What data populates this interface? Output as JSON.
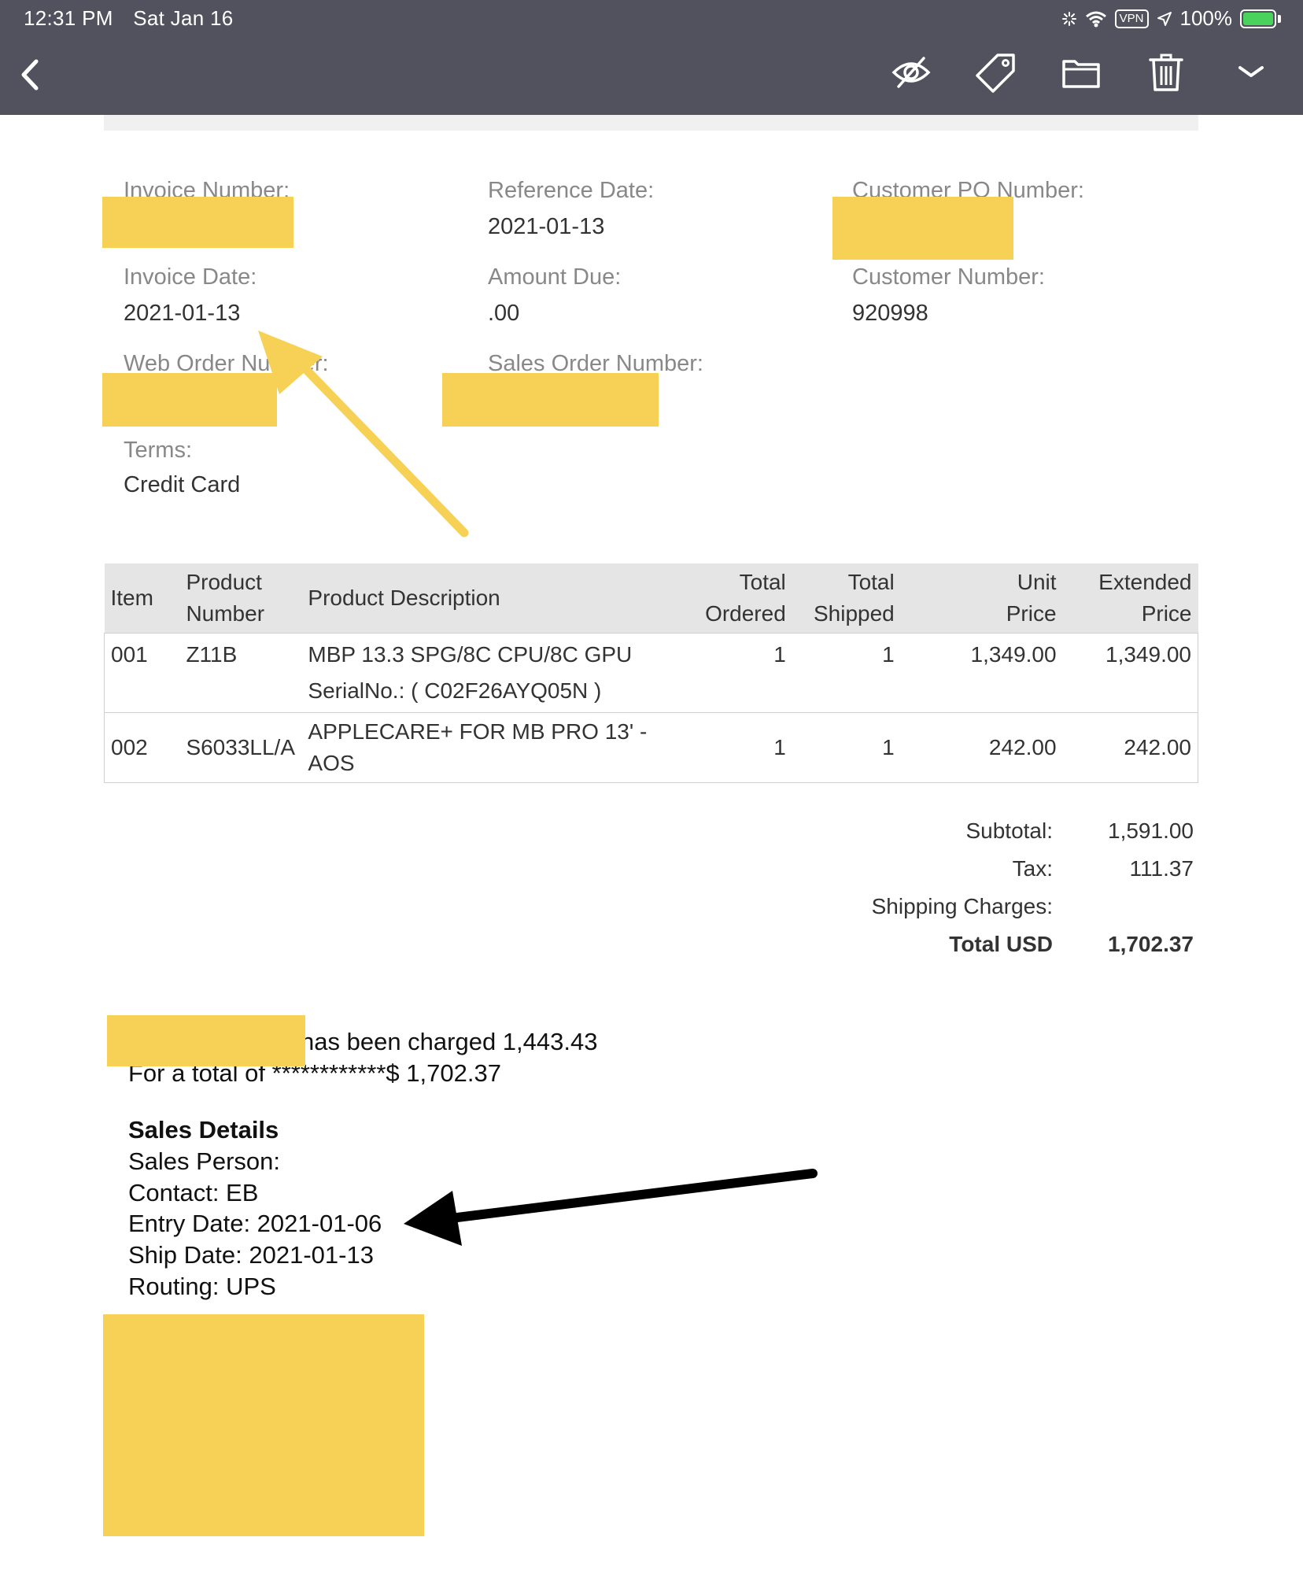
{
  "status": {
    "time": "12:31 PM",
    "date": "Sat Jan 16",
    "vpn": "VPN",
    "battery": "100%"
  },
  "toolbar": {
    "icons": [
      "back-icon",
      "hide-icon",
      "tag-icon",
      "folder-icon",
      "trash-icon",
      "chevron-down-icon"
    ]
  },
  "invoice": {
    "invoice_number_label": "Invoice Number:",
    "reference_date_label": "Reference Date:",
    "reference_date": "2021-01-13",
    "customer_po_label": "Customer PO Number:",
    "invoice_date_label": "Invoice Date:",
    "invoice_date": "2021-01-13",
    "amount_due_label": "Amount Due:",
    "amount_due": ".00",
    "customer_number_label": "Customer Number:",
    "customer_number": "920998",
    "web_order_label": "Web Order Number:",
    "sales_order_label": "Sales Order Number:",
    "terms_label": "Terms:",
    "terms": "Credit Card"
  },
  "table": {
    "headers": {
      "item": "Item",
      "product_number_1": "Product",
      "product_number_2": "Number",
      "description": "Product Description",
      "ordered_1": "Total",
      "ordered_2": "Ordered",
      "shipped_1": "Total",
      "shipped_2": "Shipped",
      "unit_1": "Unit",
      "unit_2": "Price",
      "ext_1": "Extended",
      "ext_2": "Price"
    },
    "rows": [
      {
        "item": "001",
        "product": "Z11B",
        "desc1": "MBP 13.3 SPG/8C CPU/8C GPU",
        "desc2": "SerialNo.: ( C02F26AYQ05N )",
        "ordered": "1",
        "shipped": "1",
        "unit": "1,349.00",
        "extended": "1,349.00"
      },
      {
        "item": "002",
        "product": "S6033LL/A",
        "desc1": "APPLECARE+ FOR MB PRO 13' -",
        "desc2": "AOS",
        "ordered": "1",
        "shipped": "1",
        "unit": "242.00",
        "extended": "242.00"
      }
    ]
  },
  "totals": {
    "subtotal_label": "Subtotal:",
    "subtotal": "1,591.00",
    "tax_label": "Tax:",
    "tax": "111.37",
    "shipping_label": "Shipping Charges:",
    "total_label": "Total USD",
    "total": "1,702.37"
  },
  "payment": {
    "charged": "has been charged 1,443.43",
    "total_line": "For a total of ************$ 1,702.37"
  },
  "sales": {
    "heading": "Sales Details",
    "person": "Sales Person:",
    "contact": "Contact: EB",
    "entry_date": "Entry Date: 2021-01-06",
    "ship_date": "Ship Date: 2021-01-13",
    "routing": "Routing: UPS"
  },
  "colors": {
    "header_bg": "#51525e",
    "redaction": "#f7d155",
    "battery_green": "#49d35c"
  }
}
